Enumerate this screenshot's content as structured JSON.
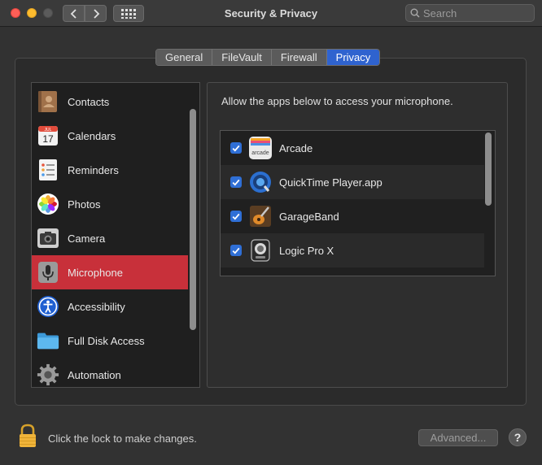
{
  "window": {
    "title": "Security & Privacy",
    "search_placeholder": "Search"
  },
  "tabs": [
    {
      "label": "General",
      "active": false
    },
    {
      "label": "FileVault",
      "active": false
    },
    {
      "label": "Firewall",
      "active": false
    },
    {
      "label": "Privacy",
      "active": true
    }
  ],
  "sidebar": {
    "items": [
      {
        "label": "Contacts",
        "icon": "contacts-icon"
      },
      {
        "label": "Calendars",
        "icon": "calendar-icon",
        "icon_text": "17",
        "icon_month": "JUL"
      },
      {
        "label": "Reminders",
        "icon": "reminders-icon"
      },
      {
        "label": "Photos",
        "icon": "photos-icon"
      },
      {
        "label": "Camera",
        "icon": "camera-icon"
      },
      {
        "label": "Microphone",
        "icon": "microphone-icon",
        "selected": true
      },
      {
        "label": "Accessibility",
        "icon": "accessibility-icon"
      },
      {
        "label": "Full Disk Access",
        "icon": "folder-icon"
      },
      {
        "label": "Automation",
        "icon": "gear-icon"
      }
    ]
  },
  "content": {
    "prompt": "Allow the apps below to access your microphone.",
    "apps": [
      {
        "name": "Arcade",
        "checked": true,
        "icon": "arcade-icon",
        "icon_text": "arcade"
      },
      {
        "name": "QuickTime Player.app",
        "checked": true,
        "icon": "quicktime-icon"
      },
      {
        "name": "GarageBand",
        "checked": true,
        "icon": "garageband-icon"
      },
      {
        "name": "Logic Pro X",
        "checked": true,
        "icon": "logic-pro-icon"
      }
    ]
  },
  "footer": {
    "lock_text": "Click the lock to make changes.",
    "advanced_label": "Advanced...",
    "help_label": "?"
  },
  "colors": {
    "selection": "#c8303a",
    "accent": "#2f63cf",
    "checkbox": "#2f6fd6"
  }
}
